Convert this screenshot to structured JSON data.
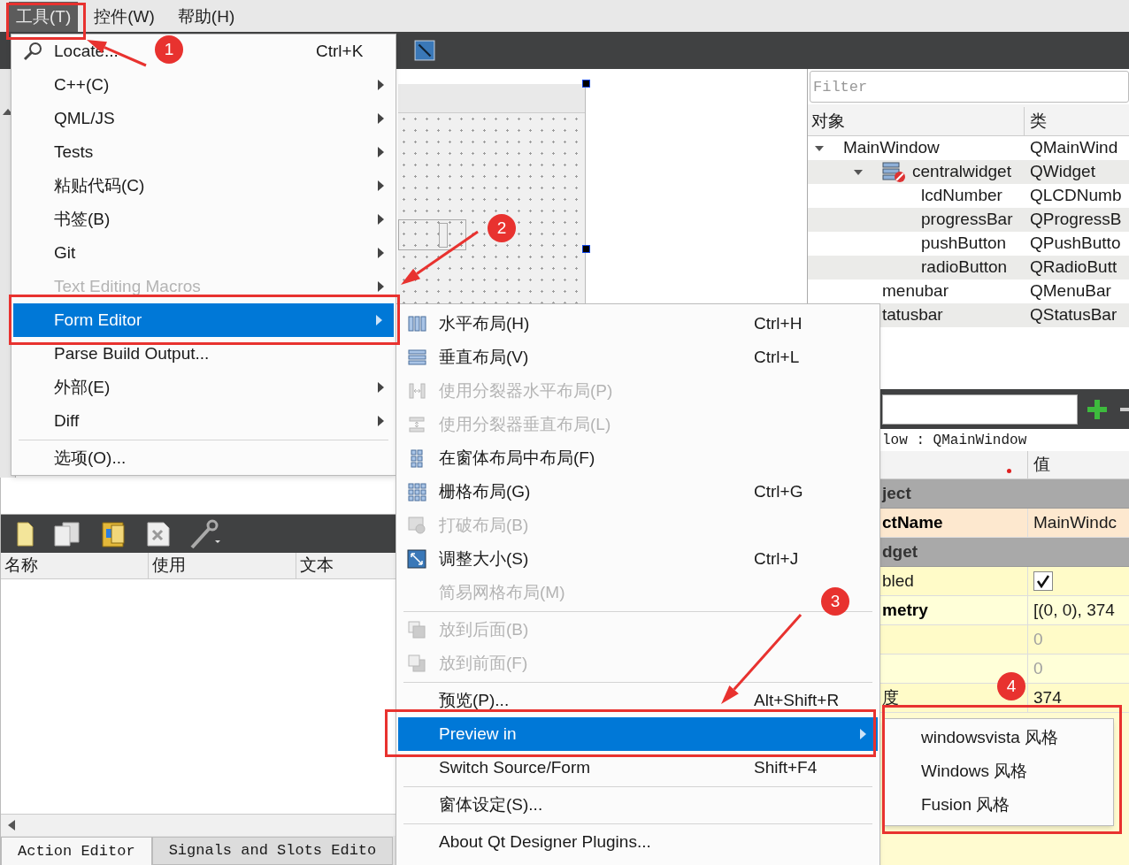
{
  "menubar": [
    {
      "label": "工具(T)",
      "selected": true
    },
    {
      "label": "控件(W)",
      "selected": false
    },
    {
      "label": "帮助(H)",
      "selected": false
    }
  ],
  "tools_menu": [
    {
      "kind": "item",
      "label": "Locate...",
      "shortcut": "Ctrl+K",
      "submenu": false,
      "disabled": false,
      "selected": false
    },
    {
      "kind": "item",
      "label": "C++(C)",
      "submenu": true,
      "disabled": false,
      "selected": false
    },
    {
      "kind": "item",
      "label": "QML/JS",
      "submenu": true,
      "disabled": false,
      "selected": false
    },
    {
      "kind": "item",
      "label": "Tests",
      "submenu": true,
      "disabled": false,
      "selected": false
    },
    {
      "kind": "item",
      "label": "粘贴代码(C)",
      "submenu": true,
      "disabled": false,
      "selected": false
    },
    {
      "kind": "item",
      "label": "书签(B)",
      "submenu": true,
      "disabled": false,
      "selected": false
    },
    {
      "kind": "item",
      "label": "Git",
      "submenu": true,
      "disabled": false,
      "selected": false
    },
    {
      "kind": "item",
      "label": "Text Editing Macros",
      "submenu": true,
      "disabled": true,
      "selected": false
    },
    {
      "kind": "item",
      "label": "Form Editor",
      "submenu": true,
      "disabled": false,
      "selected": true
    },
    {
      "kind": "item",
      "label": "Parse Build Output...",
      "submenu": false,
      "disabled": false,
      "selected": false
    },
    {
      "kind": "item",
      "label": "外部(E)",
      "submenu": true,
      "disabled": false,
      "selected": false
    },
    {
      "kind": "item",
      "label": "Diff",
      "submenu": true,
      "disabled": false,
      "selected": false
    },
    {
      "kind": "separator"
    },
    {
      "kind": "item",
      "label": "选项(O)...",
      "submenu": false,
      "disabled": false,
      "selected": false
    }
  ],
  "form_editor_menu": [
    {
      "kind": "item",
      "label": "水平布局(H)",
      "shortcut": "Ctrl+H",
      "submenu": false,
      "disabled": false,
      "selected": false
    },
    {
      "kind": "item",
      "label": "垂直布局(V)",
      "shortcut": "Ctrl+L",
      "submenu": false,
      "disabled": false,
      "selected": false
    },
    {
      "kind": "item",
      "label": "使用分裂器水平布局(P)",
      "submenu": false,
      "disabled": true,
      "selected": false
    },
    {
      "kind": "item",
      "label": "使用分裂器垂直布局(L)",
      "submenu": false,
      "disabled": true,
      "selected": false
    },
    {
      "kind": "item",
      "label": "在窗体布局中布局(F)",
      "submenu": false,
      "disabled": false,
      "selected": false
    },
    {
      "kind": "item",
      "label": "栅格布局(G)",
      "shortcut": "Ctrl+G",
      "submenu": false,
      "disabled": false,
      "selected": false
    },
    {
      "kind": "item",
      "label": "打破布局(B)",
      "submenu": false,
      "disabled": true,
      "selected": false
    },
    {
      "kind": "item",
      "label": "调整大小(S)",
      "shortcut": "Ctrl+J",
      "submenu": false,
      "disabled": false,
      "selected": false
    },
    {
      "kind": "item",
      "label": "简易网格布局(M)",
      "submenu": false,
      "disabled": true,
      "selected": false
    },
    {
      "kind": "separator"
    },
    {
      "kind": "item",
      "label": "放到后面(B)",
      "submenu": false,
      "disabled": true,
      "selected": false
    },
    {
      "kind": "item",
      "label": "放到前面(F)",
      "submenu": false,
      "disabled": true,
      "selected": false
    },
    {
      "kind": "separator"
    },
    {
      "kind": "item",
      "label": "预览(P)...",
      "shortcut": "Alt+Shift+R",
      "submenu": false,
      "disabled": false,
      "selected": false
    },
    {
      "kind": "item",
      "label": "Preview in",
      "submenu": true,
      "disabled": false,
      "selected": true
    },
    {
      "kind": "item",
      "label": "Switch Source/Form",
      "shortcut": "Shift+F4",
      "submenu": false,
      "disabled": false,
      "selected": false
    },
    {
      "kind": "separator"
    },
    {
      "kind": "item",
      "label": "窗体设定(S)...",
      "submenu": false,
      "disabled": false,
      "selected": false
    },
    {
      "kind": "separator"
    },
    {
      "kind": "item",
      "label": "About Qt Designer Plugins...",
      "submenu": false,
      "disabled": false,
      "selected": false
    }
  ],
  "preview_menu": [
    {
      "label": "windowsvista 风格"
    },
    {
      "label": "Windows 风格"
    },
    {
      "label": "Fusion 风格"
    }
  ],
  "object_inspector": {
    "filter_placeholder": "Filter",
    "columns": [
      "对象",
      "类"
    ],
    "tree": [
      {
        "name": "MainWindow",
        "class": "QMainWind",
        "expanded": true,
        "children": [
          {
            "name": "centralwidget",
            "class": "QWidget",
            "expanded": true,
            "children": [
              {
                "name": "lcdNumber",
                "class": "QLCDNumb"
              },
              {
                "name": "progressBar",
                "class": "QProgressB"
              },
              {
                "name": "pushButton",
                "class": "QPushButto"
              },
              {
                "name": "radioButton",
                "class": "QRadioButt"
              }
            ]
          },
          {
            "name": "menubar",
            "class": "QMenuBar"
          },
          {
            "name": "tatusbar",
            "class": "QStatusBar"
          }
        ]
      }
    ]
  },
  "property_editor": {
    "caption": "low : QMainWindow",
    "value_column": "值",
    "rows": [
      {
        "kind": "group",
        "name": "ject"
      },
      {
        "kind": "property",
        "name": "ctName",
        "value": "MainWindc",
        "bold": true,
        "disabled": false
      },
      {
        "kind": "group",
        "name": "dget"
      },
      {
        "kind": "checkbox",
        "name": "bled",
        "checked": true
      },
      {
        "kind": "property",
        "name": "metry",
        "value": "[(0, 0), 374",
        "bold": true,
        "disabled": false
      },
      {
        "kind": "property",
        "value": "0",
        "disabled": true
      },
      {
        "kind": "property",
        "value": "0",
        "disabled": true
      },
      {
        "kind": "property",
        "name": "度",
        "value": "374",
        "bold": false,
        "disabled": false
      }
    ]
  },
  "action_editor": {
    "columns": [
      "名称",
      "使用",
      "文本"
    ],
    "tabs": [
      {
        "label": "Action Editor",
        "selected": true
      },
      {
        "label": "Signals and Slots Edito",
        "selected": false
      }
    ]
  },
  "annotations": [
    {
      "number": "1"
    },
    {
      "number": "2"
    },
    {
      "number": "3"
    },
    {
      "number": "4"
    }
  ]
}
